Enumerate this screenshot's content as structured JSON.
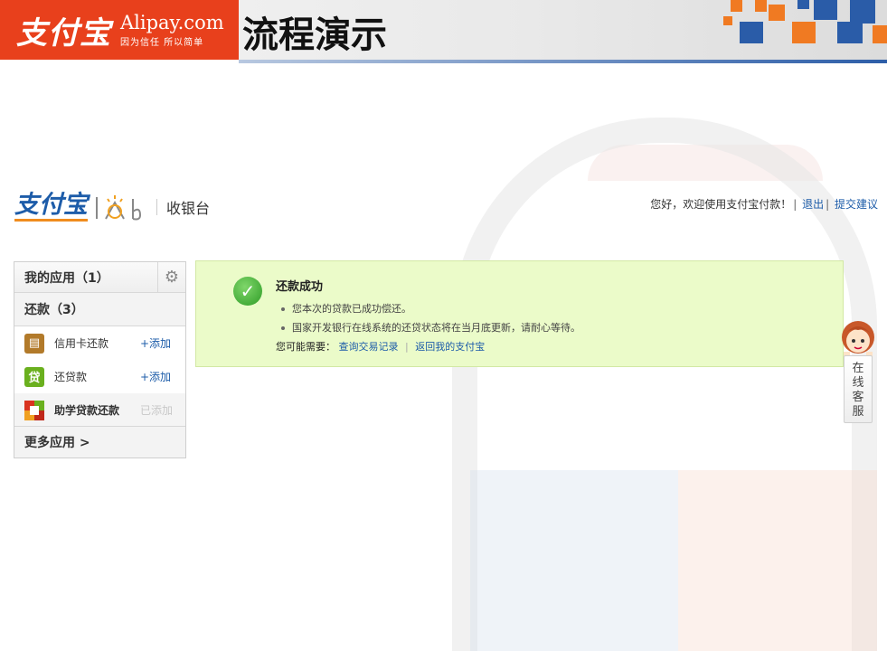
{
  "banner": {
    "logo_cn": "支付宝",
    "logo_en": "Alipay.com",
    "slogan": "因为信任 所以简单",
    "title": "流程演示"
  },
  "header": {
    "logo_cn": "支付宝",
    "subtitle": "收银台",
    "greeting": "您好，欢迎使用支付宝付款！",
    "logout": "退出",
    "feedback": "提交建议"
  },
  "sidebar": {
    "my_apps": "我的应用（1）",
    "repay_section": "还款（3）",
    "items": [
      {
        "icon": "credit-card-icon",
        "name": "信用卡还款",
        "action": "+添加",
        "color": "#b27a2a"
      },
      {
        "icon": "loan-icon",
        "name": "还贷款",
        "action": "+添加",
        "color": "#6ab01e"
      },
      {
        "icon": "student-loan-icon",
        "name": "助学贷款还款",
        "action": "已添加",
        "color": "#d9331f"
      }
    ],
    "more": "更多应用 >"
  },
  "success": {
    "title": "还款成功",
    "lines": [
      "您本次的贷款已成功偿还。",
      "国家开发银行在线系统的还贷状态将在当月底更新，请耐心等待。"
    ],
    "prompt": "您可能需要：",
    "link_records": "查询交易记录",
    "link_home": "返回我的支付宝"
  },
  "service": {
    "chars": [
      "在",
      "线",
      "客",
      "服"
    ]
  },
  "colors": {
    "brand_orange": "#e8401c",
    "link_blue": "#1d5ca9",
    "success_bg": "#ebfbc9"
  }
}
